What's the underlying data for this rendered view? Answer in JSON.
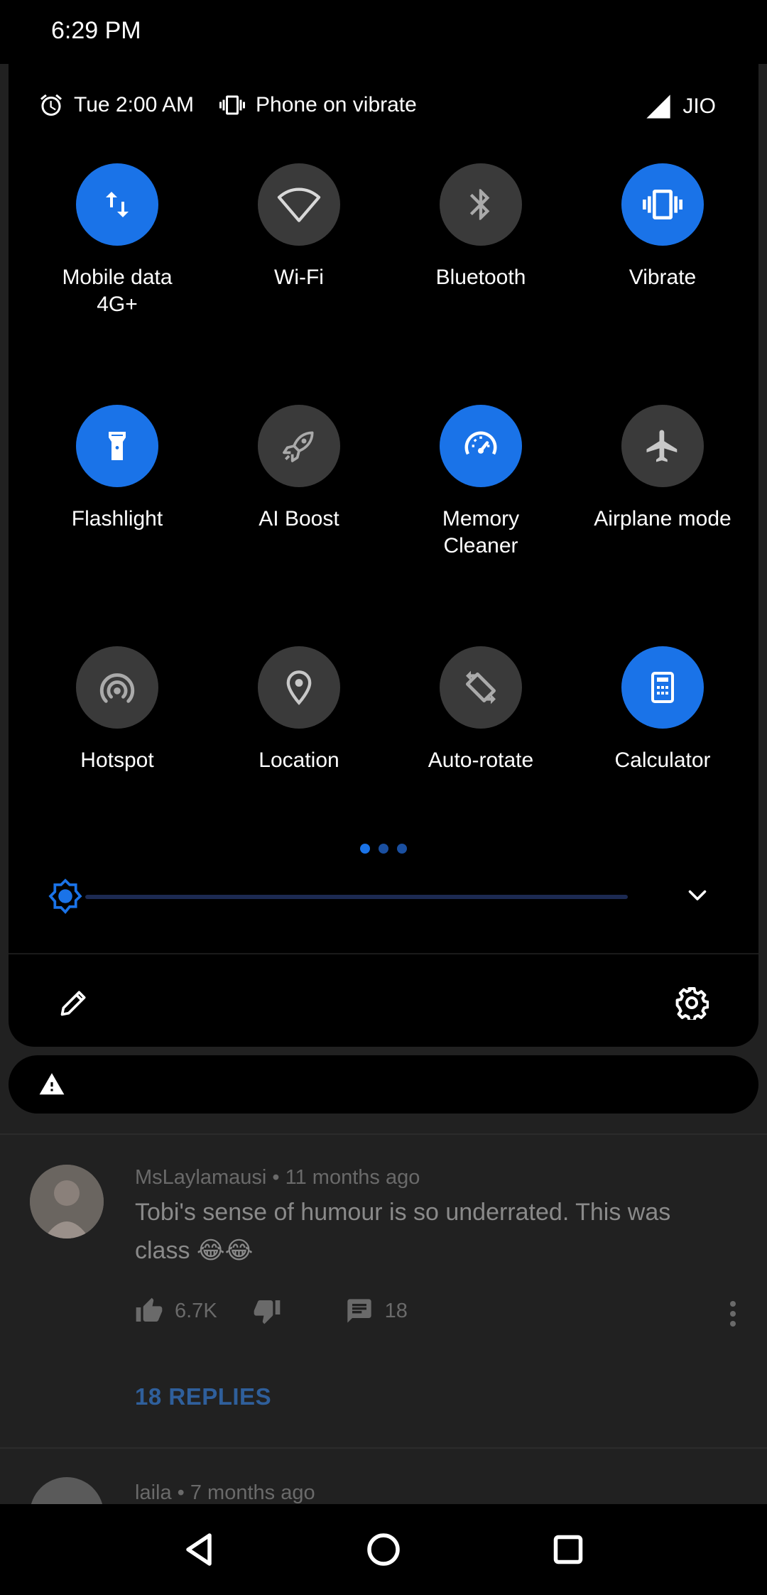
{
  "status_bar": {
    "time": "6:29 PM"
  },
  "panel_header": {
    "alarm": "Tue 2:00 AM",
    "ringer": "Phone on vibrate",
    "carrier": "JIO"
  },
  "tiles": [
    {
      "label": "Mobile data\n4G+",
      "icon": "mobile-data-icon",
      "state": "on"
    },
    {
      "label": "Wi-Fi",
      "icon": "wifi-icon",
      "state": "off"
    },
    {
      "label": "Bluetooth",
      "icon": "bluetooth-icon",
      "state": "off"
    },
    {
      "label": "Vibrate",
      "icon": "vibrate-icon",
      "state": "on"
    },
    {
      "label": "Flashlight",
      "icon": "flashlight-icon",
      "state": "on"
    },
    {
      "label": "AI Boost",
      "icon": "rocket-icon",
      "state": "off"
    },
    {
      "label": "Memory\nCleaner",
      "icon": "speedometer-icon",
      "state": "on"
    },
    {
      "label": "Airplane mode",
      "icon": "airplane-icon",
      "state": "off"
    },
    {
      "label": "Hotspot",
      "icon": "hotspot-icon",
      "state": "off"
    },
    {
      "label": "Location",
      "icon": "location-icon",
      "state": "off"
    },
    {
      "label": "Auto-rotate",
      "icon": "auto-rotate-icon",
      "state": "off"
    },
    {
      "label": "Calculator",
      "icon": "calculator-icon",
      "state": "on"
    }
  ],
  "page_indicator": {
    "pages": 3,
    "current": 1
  },
  "brightness": {
    "level": 0.0
  },
  "colors": {
    "accent": "#1a73e8",
    "tile_off": "#3a3a3a",
    "panel": "#000000"
  },
  "comments": [
    {
      "author": "MsLaylamausi",
      "age": "11 months ago",
      "text": "Tobi's sense of humour is so underrated. This was class 😂😂",
      "likes": "6.7K",
      "reply_count": "18",
      "replies_label": "18 REPLIES"
    },
    {
      "author": "laila",
      "age": "7 months ago"
    }
  ]
}
